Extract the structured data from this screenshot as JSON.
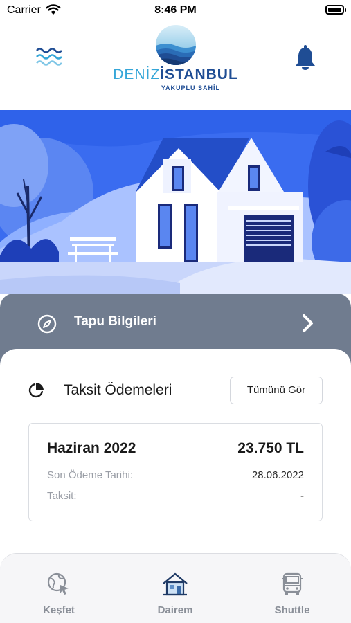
{
  "status_bar": {
    "carrier": "Carrier",
    "time": "8:46 PM"
  },
  "header": {
    "logo_part1": "DENİZ",
    "logo_part2": "İSTANBUL",
    "logo_sub": "YAKUPLU SAHİL"
  },
  "tapu": {
    "label": "Tapu Bilgileri"
  },
  "installments": {
    "title": "Taksit Ödemeleri",
    "see_all_label": "Tümünü Gör",
    "card": {
      "month": "Haziran 2022",
      "amount": "23.750 TL",
      "due_label": "Son Ödeme Tarihi:",
      "due_value": "28.06.2022",
      "installment_label": "Taksit:",
      "installment_value": "-"
    }
  },
  "tabs": [
    {
      "label": "Keşfet",
      "icon": "globe-cursor-icon"
    },
    {
      "label": "Dairem",
      "icon": "house-icon"
    },
    {
      "label": "Shuttle",
      "icon": "bus-icon"
    }
  ],
  "colors": {
    "brand_dark": "#1f4d94",
    "brand_light": "#35a6d8",
    "hero_blue": "#2f62ea",
    "tapu_bar": "#707c8f",
    "tab_label": "#8a8f98"
  }
}
